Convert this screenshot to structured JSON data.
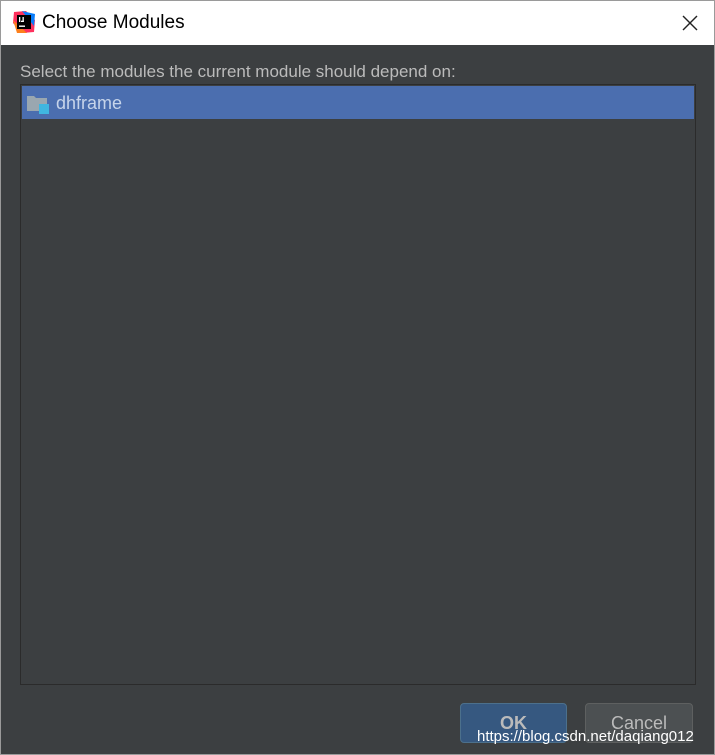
{
  "window": {
    "title": "Choose Modules",
    "close_icon": "close-icon",
    "app_icon": "intellij-idea-icon"
  },
  "dialog": {
    "instruction": "Select the modules the current module should depend on:",
    "modules": [
      {
        "name": "dhframe",
        "icon": "module-folder-icon",
        "selected": true
      }
    ]
  },
  "buttons": {
    "ok_label": "OK",
    "cancel_label": "Cancel"
  },
  "watermark": "https://blog.csdn.net/daqiang012",
  "colors": {
    "dialog_background": "#3c3f41",
    "selection": "#4b6eaf",
    "ok_button": "#365880",
    "cancel_button": "#4c5052",
    "text": "#bbbbbb"
  }
}
